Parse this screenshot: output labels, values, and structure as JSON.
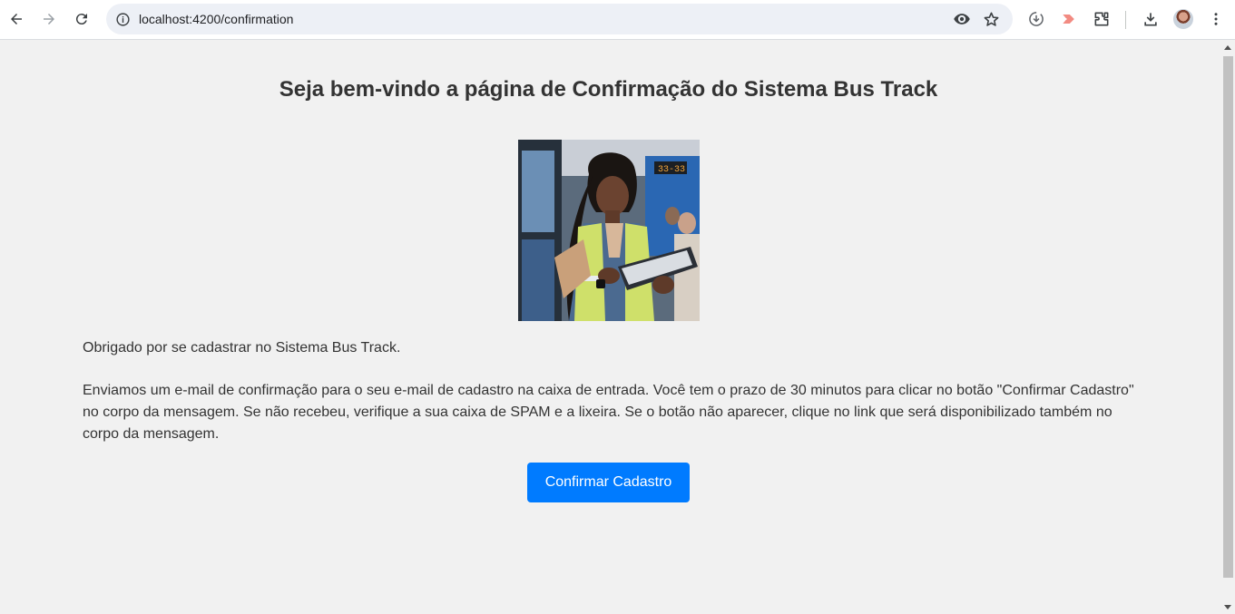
{
  "browser": {
    "url": "localhost:4200/confirmation"
  },
  "page": {
    "title": "Seja bem-vindo a página de Confirmação do Sistema Bus Track",
    "thanks_text": "Obrigado por se cadastrar no Sistema Bus Track.",
    "instructions_text": "Enviamos um e-mail de confirmação para o seu e-mail de cadastro na caixa de entrada. Você tem o prazo de 30 minutos para clicar no botão \"Confirmar Cadastro\" no corpo da mensagem. Se não recebeu, verifique a sua caixa de SPAM e a lixeira. Se o botão não aparecer, clique no link que será disponibilizado também no corpo da mensagem.",
    "confirm_button_label": "Confirmar Cadastro",
    "bus_sign_text": "33-33"
  },
  "colors": {
    "accent": "#007bff",
    "page_background": "#f1f1f1",
    "text": "#333333"
  },
  "icons": {
    "toolbar": [
      "back-arrow-icon",
      "forward-arrow-icon",
      "reload-icon",
      "site-info-icon",
      "eye-icon",
      "star-icon",
      "download-circle-icon",
      "extension-cast-icon",
      "puzzle-icon",
      "download-icon",
      "avatar",
      "kebab-menu-icon"
    ]
  }
}
